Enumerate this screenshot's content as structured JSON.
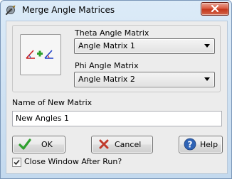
{
  "window": {
    "title": "Merge Angle Matrices",
    "close_label": "Close"
  },
  "theta": {
    "label": "Theta Angle Matrix",
    "selected": "Angle Matrix 1"
  },
  "phi": {
    "label": "Phi Angle Matrix",
    "selected": "Angle Matrix 2"
  },
  "new_matrix": {
    "label": "Name of New Matrix",
    "value": "New Angles 1"
  },
  "buttons": {
    "ok": "OK",
    "cancel": "Cancel",
    "help": "Help"
  },
  "close_after_run": {
    "label": "Close Window After Run?",
    "checked": true
  },
  "icons": {
    "app": "wrench-gear-icon",
    "merge": "angle-merge-icon",
    "ok": "check-icon",
    "cancel": "x-icon",
    "help": "question-icon"
  },
  "colors": {
    "accent_green": "#2ea02e",
    "cancel_red": "#c0392b",
    "help_blue": "#2f63b5"
  }
}
